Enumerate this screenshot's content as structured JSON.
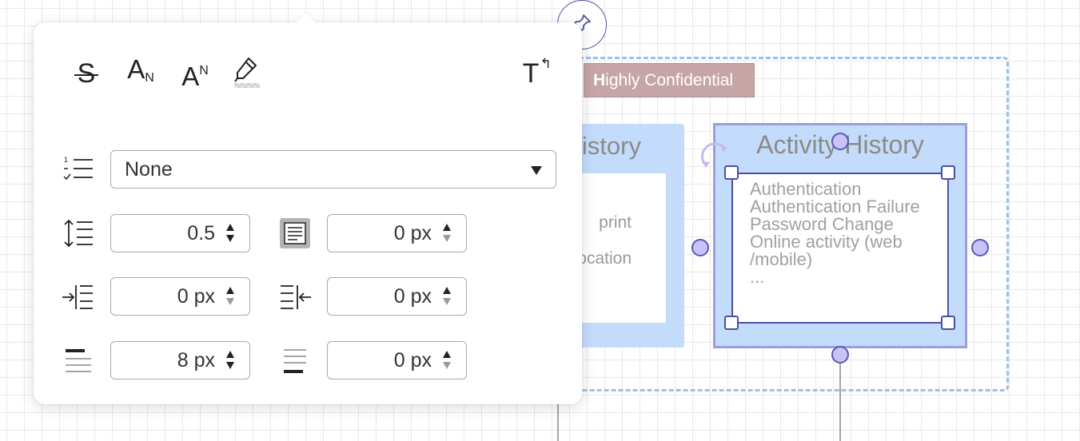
{
  "canvas": {
    "confidential_tag": {
      "first_letter": "H",
      "rest": "ighly Confidential"
    },
    "left_card": {
      "title": "istory",
      "lines": [
        "print",
        "ocation"
      ]
    },
    "right_card": {
      "title": "Activity History",
      "content_lines": [
        "Authentication",
        "Authentication Failure",
        "Password Change",
        "Online activity (web",
        "/mobile)",
        "..."
      ]
    }
  },
  "pin_button": {
    "icon": "pin-icon"
  },
  "panel": {
    "toolbar": {
      "strikethrough": "S",
      "subscript": {
        "base": "A",
        "script": "N"
      },
      "superscript": {
        "base": "A",
        "script": "N"
      },
      "highlight_icon": "highlighter-icon",
      "clear_format": {
        "base": "T",
        "mark": "↰"
      }
    },
    "list_style": {
      "icon": "list-checked-icon",
      "value": "None"
    },
    "line_spacing": {
      "icon": "line-spacing-icon",
      "value": "0.5"
    },
    "padding": {
      "icon": "text-box-icon",
      "value": "0 px"
    },
    "indent_left": {
      "icon": "indent-left-icon",
      "value": "0 px"
    },
    "indent_right": {
      "icon": "indent-right-icon",
      "value": "0 px"
    },
    "space_before": {
      "icon": "space-before-icon",
      "value": "8 px"
    },
    "space_after": {
      "icon": "space-after-icon",
      "value": "0 px"
    }
  },
  "colors": {
    "accent": "#4a4fa4",
    "card_fill": "#c4dcfb",
    "dashed_border": "#9bc0ea",
    "tag_fill": "#c6a5a6",
    "handle_fill": "#c8c3f4"
  }
}
